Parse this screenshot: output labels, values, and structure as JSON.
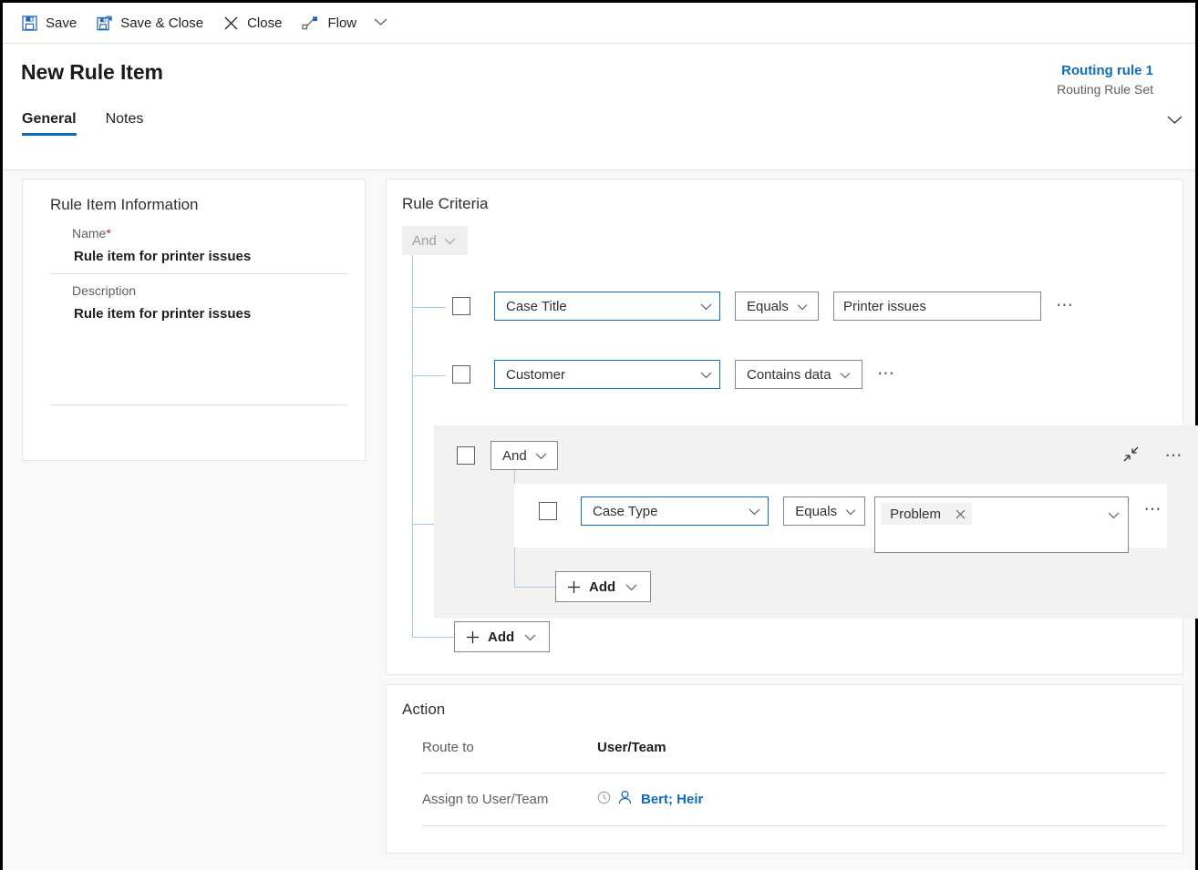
{
  "commandbar": {
    "items": [
      {
        "label": "Save",
        "icon": "save-icon"
      },
      {
        "label": "Save & Close",
        "icon": "save-and-close-icon"
      },
      {
        "label": "Close",
        "icon": "close-icon"
      },
      {
        "label": "Flow",
        "icon": "flow-icon"
      }
    ],
    "overflow_caret": "chevron-down-icon"
  },
  "header": {
    "title": "New Rule Item",
    "record_name": "Routing rule 1",
    "record_type": "Routing Rule Set",
    "expand_icon": "chevron-down-icon",
    "tabs": [
      {
        "label": "General",
        "active": true
      },
      {
        "label": "Notes",
        "active": false
      }
    ]
  },
  "rule_item_information": {
    "title": "Rule Item Information",
    "fields": [
      {
        "label": "Name",
        "required": true,
        "value": "Rule item for printer issues"
      },
      {
        "label": "Description",
        "required": false,
        "value": "Rule item for printer issues"
      }
    ]
  },
  "rule_criteria": {
    "title": "Rule Criteria",
    "root_operator": "And",
    "rows": [
      {
        "attribute": "Case Title",
        "operator": "Equals",
        "value": "Printer issues",
        "has_value_field": true,
        "more_icon": "ellipsis-icon"
      },
      {
        "attribute": "Customer",
        "operator": "Contains data",
        "value": "",
        "has_value_field": false,
        "more_icon": "ellipsis-icon"
      }
    ],
    "group": {
      "operator": "And",
      "collapse_icon": "collapse-icon",
      "more_icon": "ellipsis-icon",
      "rows": [
        {
          "attribute": "Case Type",
          "operator": "Equals",
          "tags": [
            "Problem"
          ],
          "tag_remove_icon": "close-icon",
          "dropdown_icon": "chevron-down-icon",
          "more_icon": "ellipsis-icon"
        }
      ],
      "add_label": "Add"
    },
    "add_label": "Add"
  },
  "action": {
    "title": "Action",
    "rows": [
      {
        "label": "Route to",
        "value": "User/Team",
        "style": "bold"
      },
      {
        "label": "Assign to User/Team",
        "value": "Bert; Heir",
        "style": "link",
        "icons": [
          "recent-lookup-icon",
          "contact-icon"
        ]
      }
    ]
  },
  "colors": {
    "accent": "#0f6cbd",
    "required": "#a4262c",
    "tree_line": "#a6c8f0",
    "group_bg": "#f3f2f1",
    "body_bg": "#faf9f8"
  }
}
